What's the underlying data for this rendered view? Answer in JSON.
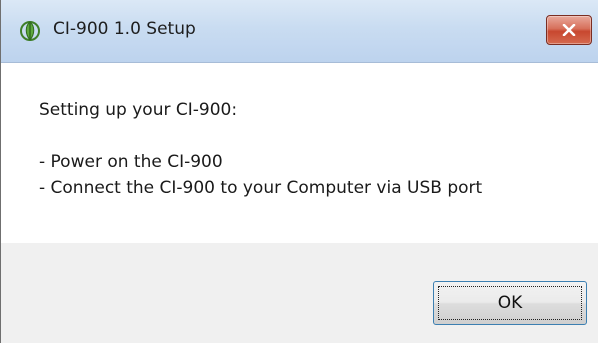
{
  "window": {
    "title": "CI-900 1.0 Setup",
    "app_icon": "green-leaf-icon",
    "close_icon": "close-icon",
    "close_color": "#c8472f"
  },
  "message": {
    "heading": "Setting up your CI-900:",
    "steps": [
      "- Power on the CI-900",
      "- Connect the CI-900 to your Computer via USB port"
    ]
  },
  "footer": {
    "ok_label": "OK"
  }
}
